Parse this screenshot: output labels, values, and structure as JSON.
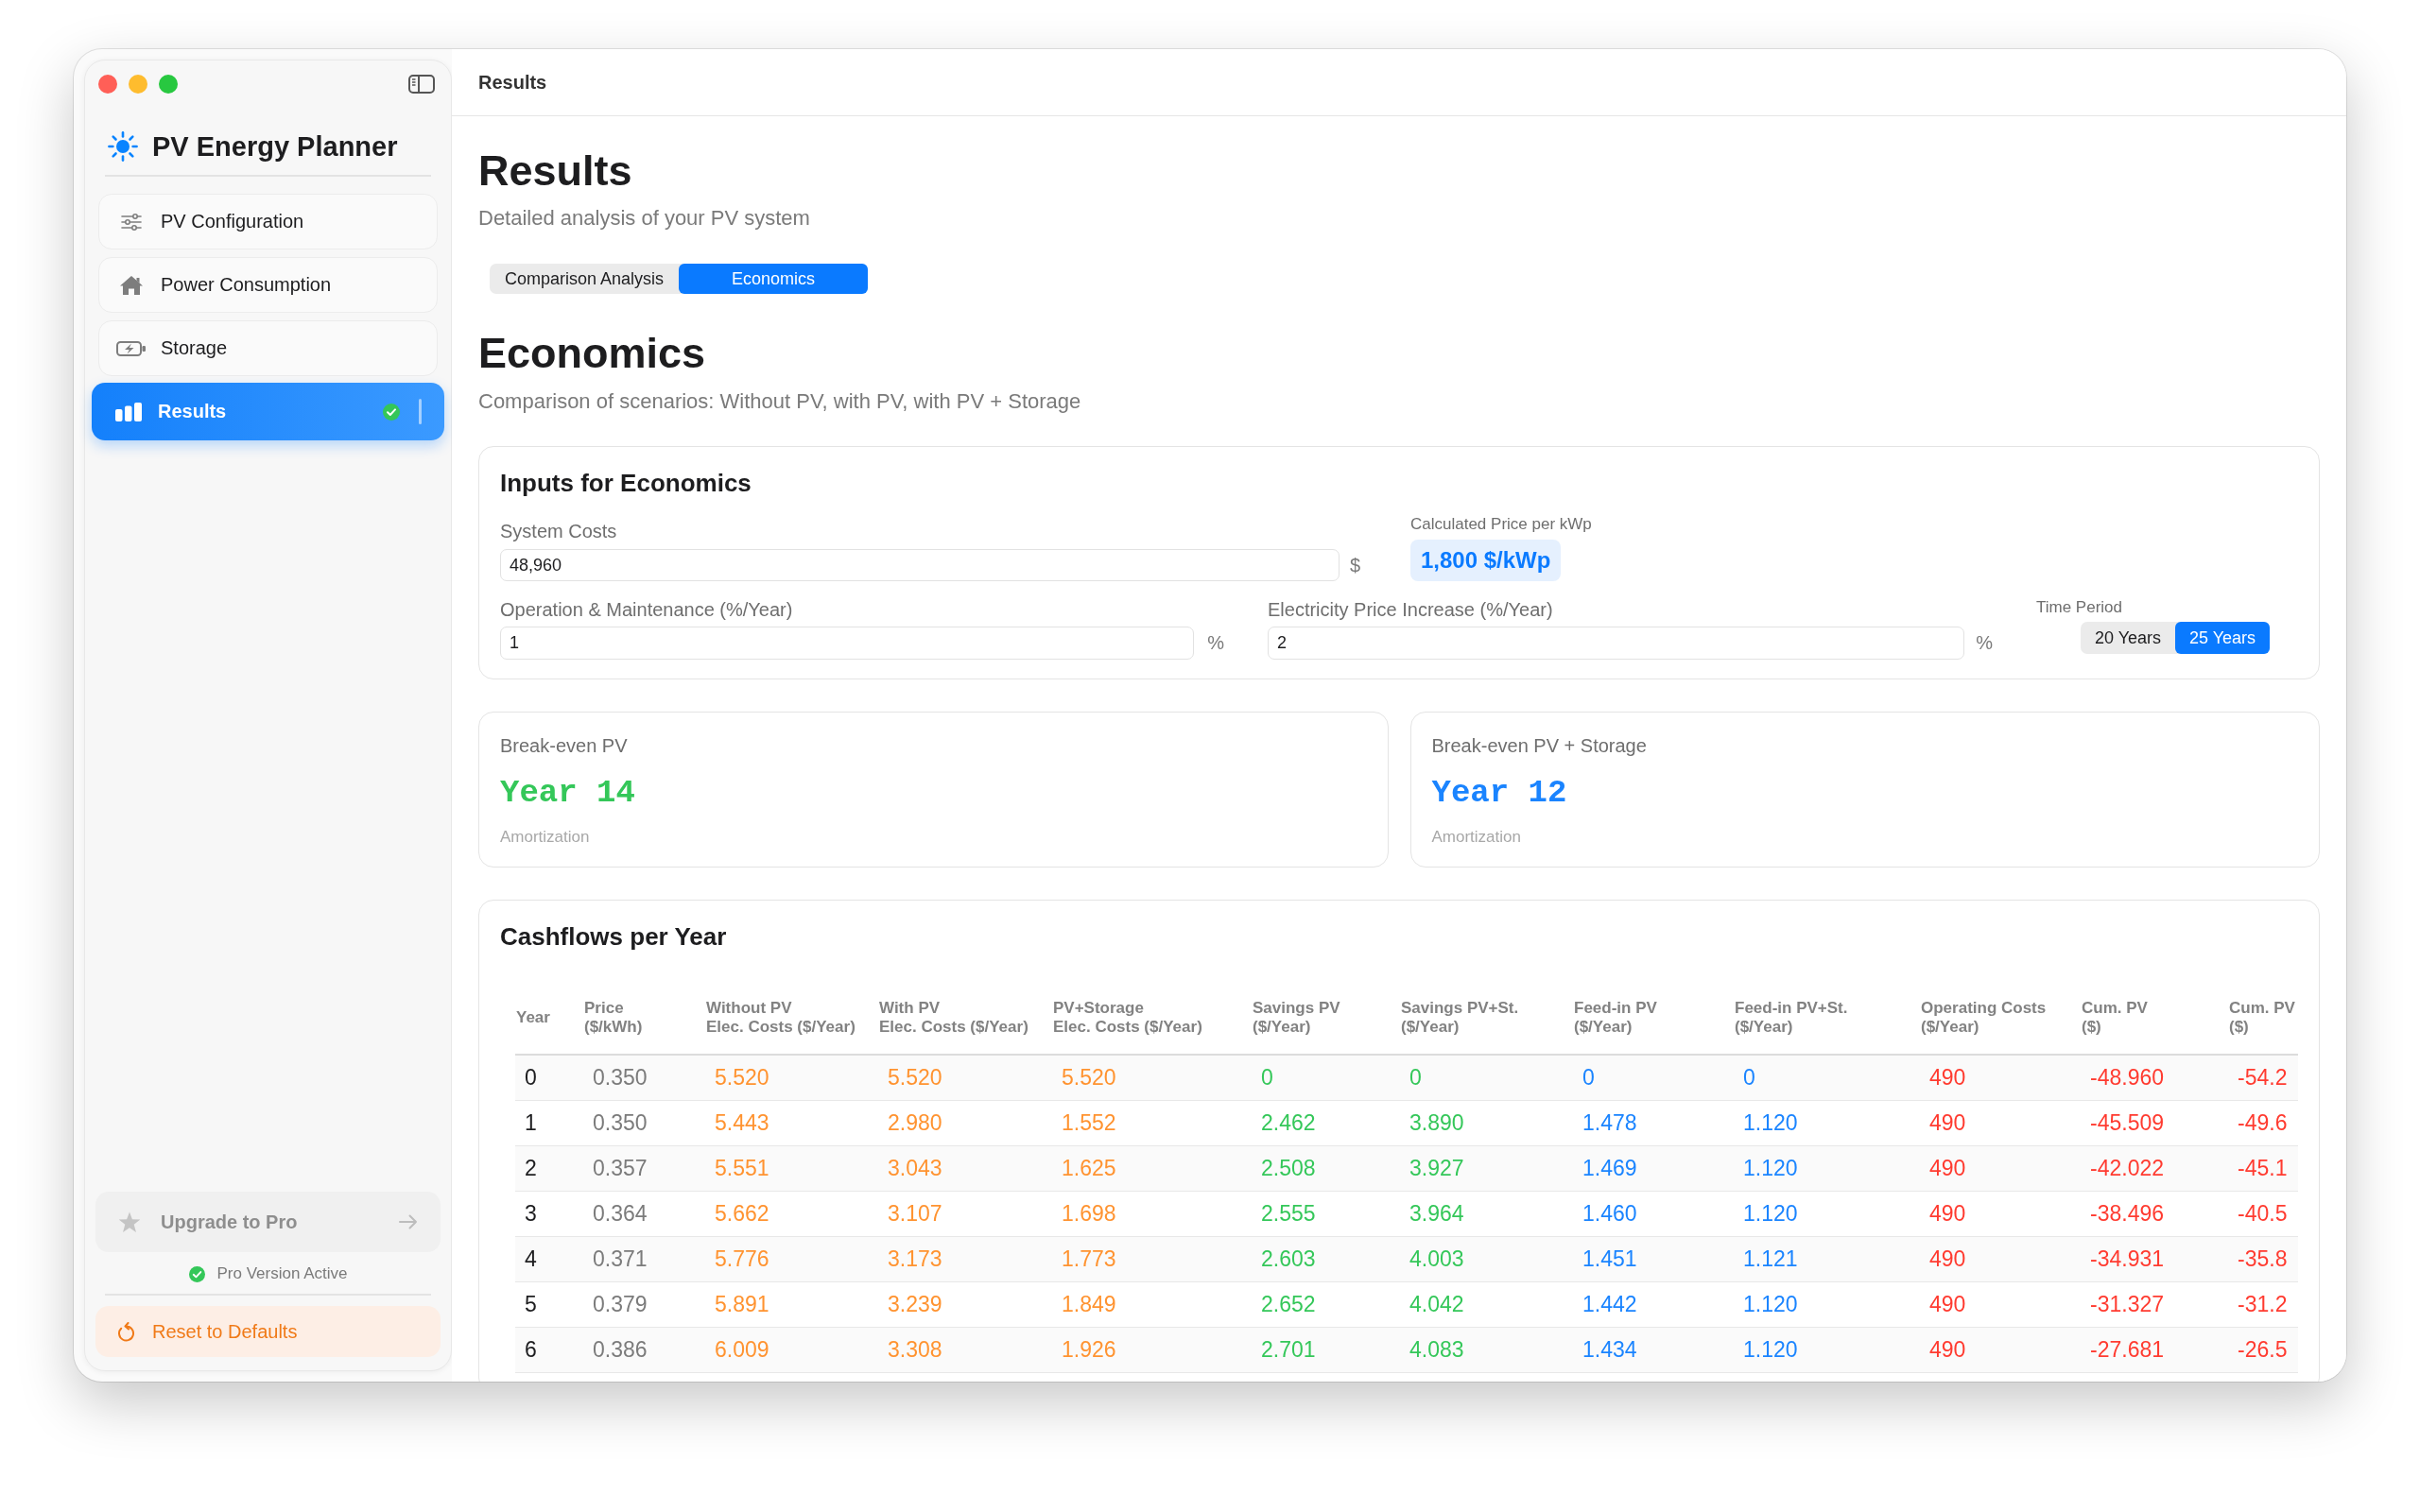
{
  "window": {
    "toolbar_title": "Results"
  },
  "sidebar": {
    "app_title": "PV Energy Planner",
    "items": [
      {
        "label": "PV Configuration",
        "selected": false,
        "complete": false
      },
      {
        "label": "Power Consumption",
        "selected": false,
        "complete": false
      },
      {
        "label": "Storage",
        "selected": false,
        "complete": false
      },
      {
        "label": "Results",
        "selected": true,
        "complete": true
      }
    ],
    "upgrade_button": {
      "label": "Upgrade to Pro",
      "disabled": true
    },
    "pro_status": "Pro Version Active",
    "reset_button": "Reset to Defaults"
  },
  "page": {
    "title": "Results",
    "subtitle": "Detailed analysis of your PV system",
    "tabs": [
      {
        "label": "Comparison Analysis",
        "selected": false
      },
      {
        "label": "Economics",
        "selected": true
      }
    ]
  },
  "section": {
    "title": "Economics",
    "subtitle": "Comparison of scenarios: Without PV, with PV, with PV + Storage"
  },
  "inputs": {
    "title": "Inputs for Economics",
    "system_costs": {
      "label": "System Costs",
      "value": "48,960",
      "unit": "$"
    },
    "price_per_kwp": {
      "label": "Calculated Price per kWp",
      "value": "1,800 $/kWp"
    },
    "maintenance": {
      "label": "Operation & Maintenance (%/Year)",
      "value": "1",
      "unit": "%"
    },
    "price_increase": {
      "label": "Electricity Price Increase (%/Year)",
      "value": "2",
      "unit": "%"
    },
    "time_period": {
      "label": "Time Period",
      "options": [
        {
          "label": "20 Years",
          "selected": false
        },
        {
          "label": "25 Years",
          "selected": true
        }
      ]
    }
  },
  "break_even": [
    {
      "label": "Break-even PV",
      "value": "Year 14",
      "caption": "Amortization",
      "color": "#34c759"
    },
    {
      "label": "Break-even PV + Storage",
      "value": "Year 12",
      "caption": "Amortization",
      "color": "#1a84ff"
    }
  ],
  "cashflows": {
    "title": "Cashflows per Year",
    "columns": [
      {
        "lines": [
          "Year"
        ],
        "color": "#1d1d1f"
      },
      {
        "lines": [
          "Price",
          "($/kWh)"
        ],
        "color": "#7b7b7b"
      },
      {
        "lines": [
          "Without PV",
          "Elec. Costs ($/Year)"
        ],
        "color": "#ff9330"
      },
      {
        "lines": [
          "With PV",
          "Elec. Costs ($/Year)"
        ],
        "color": "#ff9330"
      },
      {
        "lines": [
          "PV+Storage",
          "Elec. Costs ($/Year)"
        ],
        "color": "#ff9330"
      },
      {
        "lines": [
          "Savings PV",
          "($/Year)"
        ],
        "color": "#34c759"
      },
      {
        "lines": [
          "Savings PV+St.",
          "($/Year)"
        ],
        "color": "#34c759"
      },
      {
        "lines": [
          "Feed-in PV",
          "($/Year)"
        ],
        "color": "#1a84ff"
      },
      {
        "lines": [
          "Feed-in PV+St.",
          "($/Year)"
        ],
        "color": "#1a84ff"
      },
      {
        "lines": [
          "Operating Costs",
          "($/Year)"
        ],
        "color": "#ff3b30"
      },
      {
        "lines": [
          "Cum. PV",
          "($)"
        ],
        "color": "#ff3b30"
      },
      {
        "lines": [
          "Cum. PV",
          "($)"
        ],
        "color": "#ff3b30"
      }
    ],
    "rows": [
      [
        "0",
        "0.350",
        "5.520",
        "5.520",
        "5.520",
        "0",
        "0",
        "0",
        "0",
        "490",
        "-48.960",
        "-54.2"
      ],
      [
        "1",
        "0.350",
        "5.443",
        "2.980",
        "1.552",
        "2.462",
        "3.890",
        "1.478",
        "1.120",
        "490",
        "-45.509",
        "-49.6"
      ],
      [
        "2",
        "0.357",
        "5.551",
        "3.043",
        "1.625",
        "2.508",
        "3.927",
        "1.469",
        "1.120",
        "490",
        "-42.022",
        "-45.1"
      ],
      [
        "3",
        "0.364",
        "5.662",
        "3.107",
        "1.698",
        "2.555",
        "3.964",
        "1.460",
        "1.120",
        "490",
        "-38.496",
        "-40.5"
      ],
      [
        "4",
        "0.371",
        "5.776",
        "3.173",
        "1.773",
        "2.603",
        "4.003",
        "1.451",
        "1.121",
        "490",
        "-34.931",
        "-35.8"
      ],
      [
        "5",
        "0.379",
        "5.891",
        "3.239",
        "1.849",
        "2.652",
        "4.042",
        "1.442",
        "1.120",
        "490",
        "-31.327",
        "-31.2"
      ],
      [
        "6",
        "0.386",
        "6.009",
        "3.308",
        "1.926",
        "2.701",
        "4.083",
        "1.434",
        "1.120",
        "490",
        "-27.681",
        "-26.5"
      ]
    ]
  }
}
